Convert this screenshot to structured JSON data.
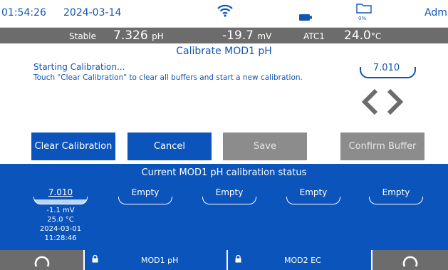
{
  "status_bar": {
    "time": "01:54:26",
    "date": "2024-03-14",
    "storage_percent": "0%",
    "user": "Admin"
  },
  "readings": {
    "stability": "Stable",
    "ph_value": "7.326",
    "ph_unit": "pH",
    "mv_value": "-19.7",
    "mv_unit": "mV",
    "temp_source": "ATC1",
    "temp_value": "24.0",
    "temp_unit": "°C"
  },
  "screen_title": "Calibrate MOD1 pH",
  "message": {
    "line1": "Starting Calibration...",
    "line2": "Touch \"Clear Calibration\" to clear all buffers and start a new calibration."
  },
  "current_buffer": "7.010",
  "buttons": {
    "clear": "Clear Calibration",
    "cancel": "Cancel",
    "save": "Save",
    "confirm": "Confirm Buffer"
  },
  "calibration_status": {
    "title": "Current MOD1 pH calibration status",
    "slots": [
      {
        "label": "7.010",
        "mv": "-1.1 mV",
        "temp": "25.0 °C",
        "date": "2024-03-01",
        "time": "11:28:46"
      },
      {
        "label": "Empty"
      },
      {
        "label": "Empty"
      },
      {
        "label": "Empty"
      },
      {
        "label": "Empty"
      }
    ]
  },
  "bottom_nav": {
    "module1": "MOD1 pH",
    "module2": "MOD2 EC"
  },
  "colors": {
    "primary_blue": "#0b54bb",
    "text_blue": "#1155b5",
    "disabled_gray": "#8c8c8c",
    "bar_gray": "#6c6c6c"
  }
}
